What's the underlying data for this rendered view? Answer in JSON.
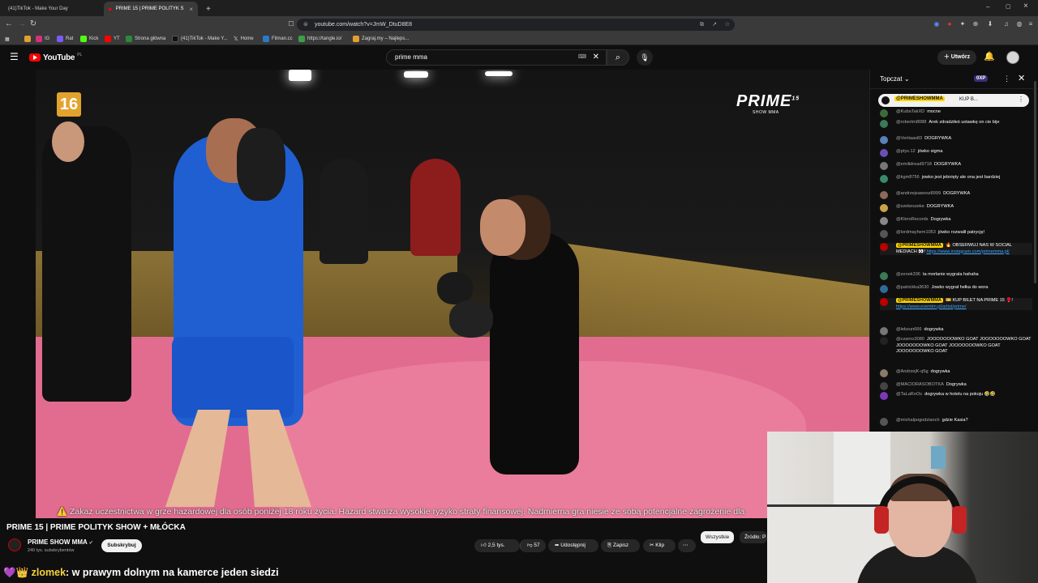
{
  "browser": {
    "tabs": [
      {
        "label": "(41)TikTok - Make Your Day"
      },
      {
        "label": "PRIME 15 | PRIME POLITYK S"
      }
    ],
    "url": "youtube.com/watch?v=JmW_DtuD8E8",
    "bookmarks": [
      "IG",
      "Rat",
      "Kick",
      "YT",
      "Strona główna",
      "(41)TikTok - Make Y...",
      "Home",
      "Filman.cc",
      "https://tangle.io/",
      "Zagraj.my – Najleps..."
    ]
  },
  "youtube": {
    "logo_text": "YouTube",
    "logo_country": "PL",
    "search_value": "prime mma",
    "create_label": "Utwórz"
  },
  "video": {
    "badge": "16",
    "brand": "PRIME",
    "brand_superscript": "15",
    "brand_sub": "SHOW MMA",
    "ticker_icon": "⚠️",
    "ticker": "Zakaz uczestnictwa w grze hazardowej dla osób poniżej 18 roku życia. Hazard stwarza wysokie ryzyko straty finansowej. Nadmierna gra niesie ze sobą potencjalne zagrożenie dla",
    "title": "PRIME 15 | PRIME POLITYK SHOW + MŁÓCKA",
    "channel": "PRIME SHOW MMA",
    "subscribers": "240 tys. subskrybentów",
    "subscribe_label": "Subskrybuj",
    "likes": "2,5 tys.",
    "dislikes": "57",
    "share_label": "Udostępnij",
    "save_label": "Zapisz",
    "clip_label": "Klip",
    "more_label": "⋯",
    "filters": [
      "Wszystkie",
      "Źródło: P"
    ]
  },
  "chat": {
    "title": "Topczat",
    "xp": "0XP",
    "pinned_author": "@PRIMESHOWMMA",
    "pinned_text": "KUP B...",
    "messages": [
      {
        "author": "@KubaTakXD",
        "text": "mocne",
        "color": "#3b6b3a"
      },
      {
        "author": "@robertm8088",
        "text": "Arek zdradziłeś ustawkę on cie bije",
        "color": "#3a7a58"
      },
      {
        "author": "@Veritaas83",
        "text": "DOGRYWKA",
        "color": "#5b7fb8"
      },
      {
        "author": "@ptys.12",
        "text": "jówko sigma",
        "color": "#6b4fb8"
      },
      {
        "author": "@emilidread9718",
        "text": "DOGRYWKA",
        "color": "#777"
      },
      {
        "author": "@kgm8756",
        "text": "jowko jest jebnięty ale ona jest bardziej",
        "color": "#3a8a6a"
      },
      {
        "author": "@andrzejsawosz8999",
        "text": "DOGRYWKA",
        "color": "#8a6a5a"
      },
      {
        "author": "@szekeszeke",
        "text": "DOGRYWKA",
        "color": "#c9a24a"
      },
      {
        "author": "@KleroRecords",
        "text": "Dogrywka",
        "color": "#888"
      },
      {
        "author": "@lordmayhem1053",
        "text": "jówko rozwalił patrycję!",
        "color": "#555"
      },
      {
        "author": "@PRIMESHOWMMA",
        "text": "🔥 OBSERWUJ NAS W SOCIAL MEDIACH 👀!",
        "link": "https://www.instagram.com/primemma.pl/",
        "mod": true,
        "color": "#b00"
      },
      {
        "author": "@zenek336",
        "text": "ta morlanie wygrala hahaha",
        "color": "#3a7a58"
      },
      {
        "author": "@patrickka3630",
        "text": "Jowko wygrał hełka do wora",
        "color": "#2f6a9a"
      },
      {
        "author": "@PRIMESHOWMMA",
        "text": "🎫 KUP BILET NA PRIME 15 🥊!",
        "link": "https://www.eventim.pl/artist/prime/",
        "mod": true,
        "color": "#b00"
      },
      {
        "author": "@lebzun666",
        "text": "dogrywka",
        "color": "#777"
      },
      {
        "author": "@czarno3080",
        "text": "JOOOOOOOWKO GOAT JOOOOOOOWKO GOAT JOOOOOOOWKO GOAT JOOOOOOOWKO GOAT JOOOOOOOWKO GOAT",
        "color": "#222"
      },
      {
        "author": "@AndrzejK-q5g",
        "text": "dogrywka",
        "color": "#8a7a6a"
      },
      {
        "author": "@MACIORASOBOTKA",
        "text": "Dogrywka",
        "color": "#444"
      },
      {
        "author": "@TaLaRoOs",
        "text": "dogrywka w hotelu na pokoju 🤣🤣",
        "color": "#7a3ab8"
      },
      {
        "author": "@michalpogodzianch",
        "text": "gdzie Kasia?",
        "color": "#555"
      }
    ]
  },
  "overlay": {
    "heart": "💜",
    "crown": "👑",
    "name": "zlomek",
    "text": ": w prawym dolnym na kamerce jeden siedzi"
  }
}
